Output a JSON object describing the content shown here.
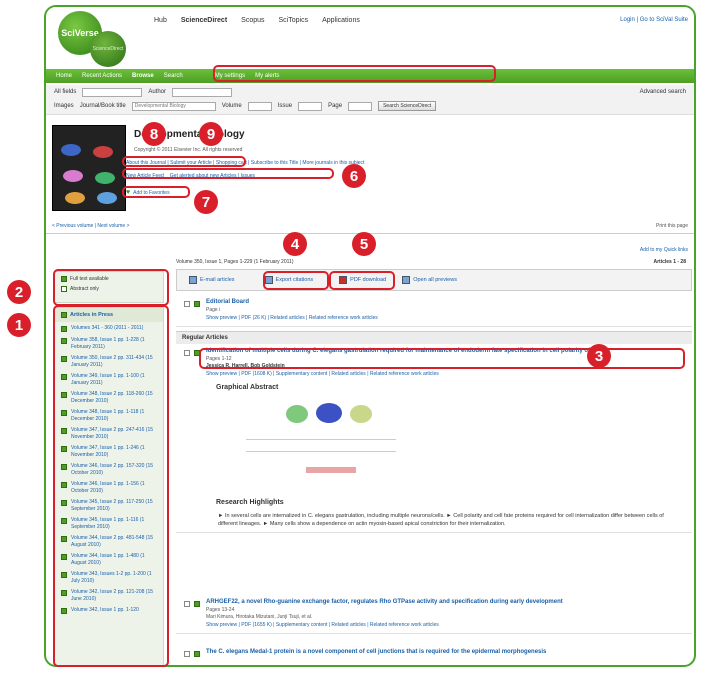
{
  "header": {
    "logo_text": "SciVerse",
    "logo_sub_text": "ScienceDirect",
    "topnav": [
      "Hub",
      "ScienceDirect",
      "Scopus",
      "SciTopics",
      "Applications"
    ],
    "toplinks": "Login | Go to SciVal Suite"
  },
  "greenbar": {
    "items": [
      "Home",
      "Recent Actions",
      "Browse",
      "Search",
      "My settings",
      "My alerts"
    ]
  },
  "search": {
    "all_fields": "All fields",
    "author": "Author",
    "images": "Images",
    "journal_label": "Journal/Book title",
    "journal_value": "Developmental Biology",
    "volume_label": "Volume",
    "issue_label": "Issue",
    "page_label": "Page",
    "button": "Search ScienceDirect",
    "advanced": "Advanced search"
  },
  "journal": {
    "title": "Developmental Biology",
    "subtitle": "Copyright © 2011 Elsevier Inc. All rights reserved",
    "about": "About this Journal",
    "submit": "Submit your Article",
    "links_rest": "Shopping cart | Subscribe to this Title | More journals in this subject",
    "new_articles": "New Article Feed",
    "alert": "Get alerted about new Articles | Issues",
    "add_fav": "Add to Favorites"
  },
  "nav": {
    "prev_next": "< Previous volume | Next volume >",
    "print": "Print this page",
    "add_list": "Add to my Quick links"
  },
  "filters": [
    "Full text available",
    "Abstract only"
  ],
  "volumes": {
    "header": "Articles in Press",
    "items": [
      "Volumes 341 - 360 (2011 - 2011)",
      "Volume 358, Issue 1 pp. 1-228 (1 February 2011)",
      "Volume 350, Issue 2 pp. 311-434 (15 January 2011)",
      "Volume 349, Issue 1 pp. 1-100 (1 January 2011)",
      "Volume 348, Issue 2 pp. 118-260 (15 December 2010)",
      "Volume 348, Issue 1 pp. 1-118 (1 December 2010)",
      "Volume 347, Issue 2 pp. 247-416 (15 November 2010)",
      "Volume 347, Issue 1 pp. 1-246 (1 November 2010)",
      "Volume 346, Issue 2 pp. 157-320 (15 October 2010)",
      "Volume 346, Issue 1 pp. 1-156 (1 October 2010)",
      "Volume 345, Issue 2 pp. 117-250 (15 September 2010)",
      "Volume 345, Issue 1 pp. 1-116 (1 September 2010)",
      "Volume 344, Issue 2 pp. 481-548 (15 August 2010)",
      "Volume 344, Issue 1 pp. 1-480 (1 August 2010)",
      "Volume 343, Issues 1-2 pp. 1-200 (1 July 2010)",
      "Volume 342, Issue 2 pp. 121-208 (15 June 2010)",
      "Volume 342, Issue 1 pp. 1-120"
    ]
  },
  "content": {
    "volinfo": "Volume 350, Issue 1, Pages 1-229 (1 February 2011)",
    "count": "Articles 1 - 28",
    "toolbar": {
      "select": "E-mail articles",
      "export": "Export citations",
      "pdf": "PDF download",
      "open_all": "Open all previews"
    },
    "article1": {
      "title": "Editorial Board",
      "pages": "Page i",
      "links": "Show preview | PDF (26 K) | Related articles | Related reference work articles"
    },
    "section_label": "Regular Articles",
    "article2": {
      "title": "Identification of multiple cells during C. elegans gastrulation required for maintenance of endoderm fate specification in cell polarity of cells",
      "authors": "Jessica R. Harrell, Bob Goldstein",
      "pages": "Pages 1-12",
      "links": "Show preview | PDF (1608 K) | Supplementary content | Related articles | Related reference work articles"
    },
    "ga_title": "Graphical Abstract",
    "rh_title": "Research Highlights",
    "rh_text": "► In several cells are internalized in C. elegans gastrulation, including multiple neurons/cells. ► Cell polarity and cell fate proteins required for cell internalization differ between cells of different lineages. ► Many cells show a dependence on actin myosin-based apical constriction for their internalization.",
    "article3": {
      "title": "ARHGEF22, a novel Rho-guanine exchange factor, regulates Rho GTPase activity and specification during early development",
      "pages": "Pages 13-24",
      "authors": "Mari Kimura, Hirotaka Mizutani, Junji Tsuji, et al.",
      "links": "Show preview | PDF (1655 K) | Supplementary content | Related articles | Related reference work articles"
    },
    "article4": {
      "title": "The C. elegans Medal-1 protein is a novel component of cell junctions that is required for the epidermal morphogenesis"
    }
  },
  "annotations": [
    "1",
    "2",
    "3",
    "4",
    "5",
    "6",
    "7",
    "8",
    "9"
  ],
  "colors": {
    "brand_green": "#4aa32a",
    "highlight_red": "#d9202a",
    "link_blue": "#1a5fa8"
  }
}
